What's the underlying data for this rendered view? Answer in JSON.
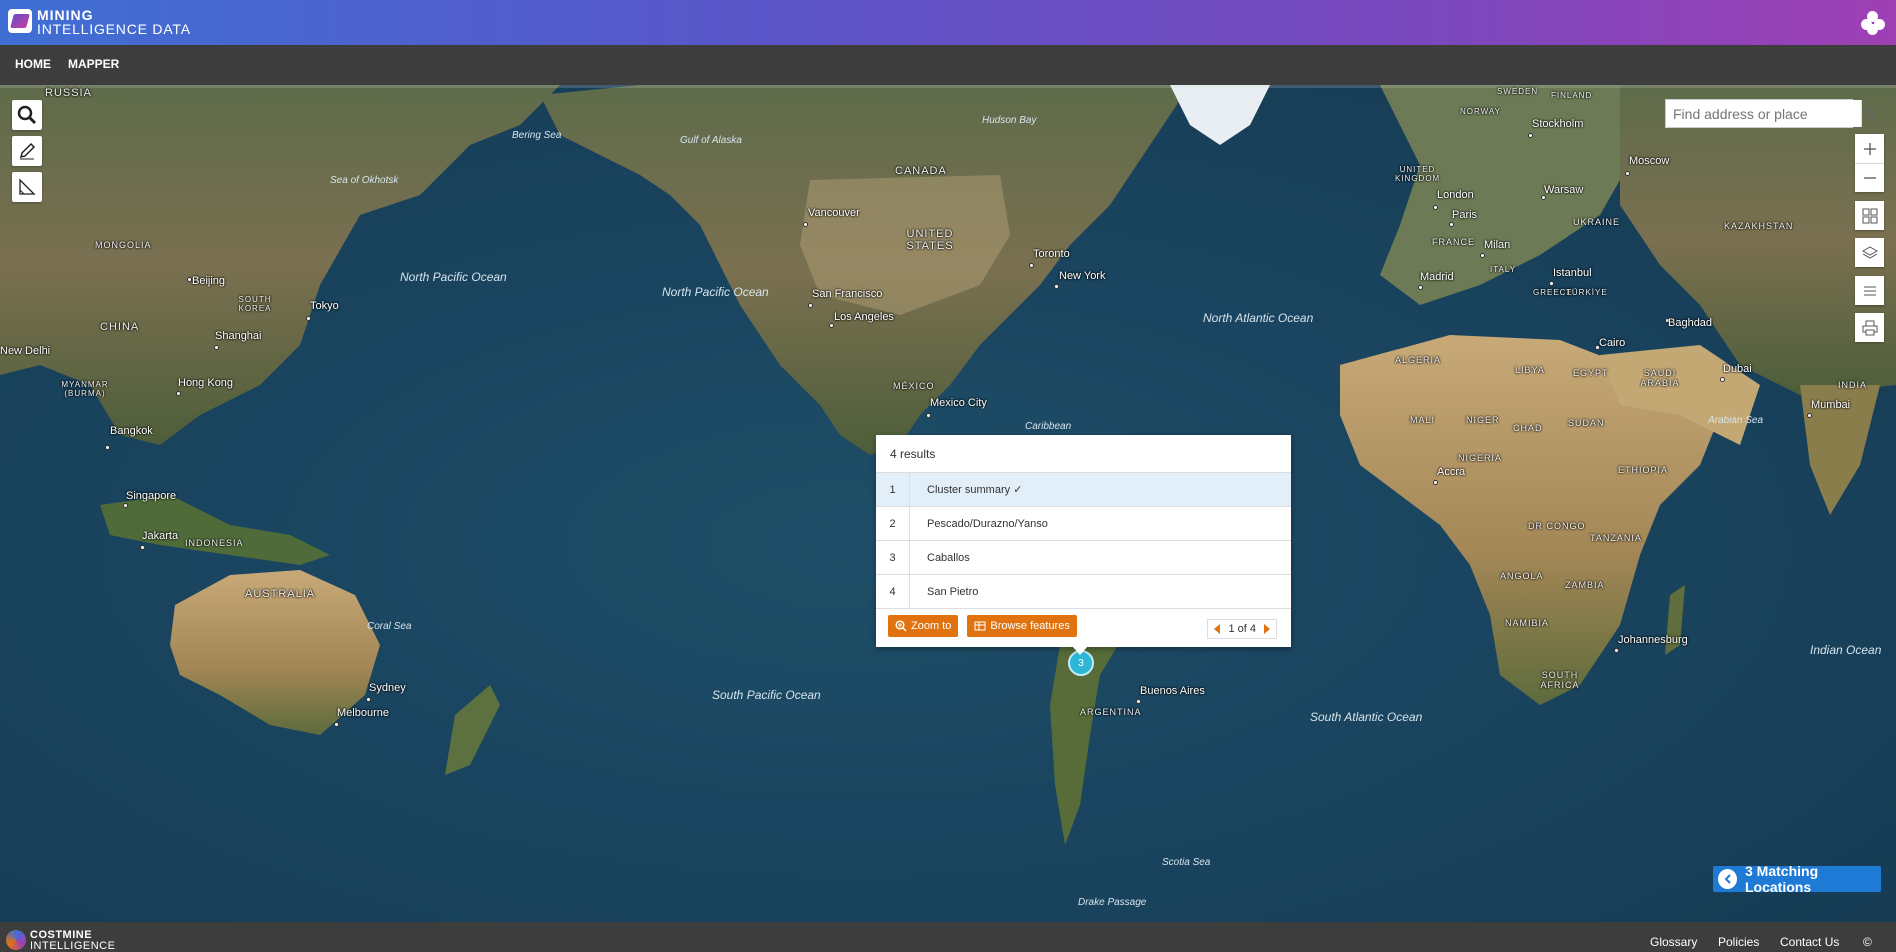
{
  "header": {
    "brand_line1": "MINING",
    "brand_line2": "INTELLIGENCE DATA"
  },
  "nav": {
    "home": "HOME",
    "mapper": "MAPPER"
  },
  "map": {
    "search_placeholder": "Find address or place",
    "labels": {
      "russia": "RUSSIA",
      "canada": "CANADA",
      "united_states": "UNITED STATES",
      "mexico": "MÉXICO",
      "china": "CHINA",
      "mongolia": "MONGOLIA",
      "australia": "AUSTRALIA",
      "indonesia": "INDONESIA",
      "algeria": "ALGERIA",
      "libya": "LIBYA",
      "egypt": "EGYPT",
      "sudan": "SUDAN",
      "chad": "CHAD",
      "niger": "NIGER",
      "mali": "MALI",
      "nigeria": "NIGERIA",
      "ethiopia": "ETHIOPIA",
      "dr_congo": "DR CONGO",
      "tanzania": "TANZANIA",
      "angola": "ANGOLA",
      "zambia": "ZAMBIA",
      "namibia": "NAMIBIA",
      "south_africa": "SOUTH AFRICA",
      "saudi_arabia": "SAUDI ARABIA",
      "argentina": "ARGENTINA",
      "ukraine": "UKRAINE",
      "kazakhstan": "KAZAKHSTAN",
      "france": "FRANCE",
      "united_kingdom": "UNITED KINGDOM",
      "norway": "NORWAY",
      "sweden": "SWEDEN",
      "finland": "FINLAND",
      "italy": "ITALY",
      "greece": "GREECE",
      "turkiye": "TÜRKİYE",
      "india": "INDIA",
      "south_korea": "SOUTH KOREA",
      "myanmar": "MYANMAR (BURMA)",
      "north_pacific_1": "North Pacific Ocean",
      "north_pacific_2": "North Pacific Ocean",
      "south_pacific": "South Pacific Ocean",
      "north_atlantic": "North Atlantic Ocean",
      "south_atlantic": "South Atlantic Ocean",
      "indian_ocean": "Indian Ocean",
      "bering_sea": "Bering Sea",
      "gulf_alaska": "Gulf of Alaska",
      "sea_okhotsk": "Sea of Okhotsk",
      "hudson_bay": "Hudson Bay",
      "coral_sea": "Coral Sea",
      "scotia_sea": "Scotia Sea",
      "drake_passage": "Drake Passage",
      "arabian_sea": "Arabian Sea",
      "caribbean": "Caribbean",
      "vancouver": "Vancouver",
      "toronto": "Toronto",
      "new_york": "New York",
      "san_francisco": "San Francisco",
      "los_angeles": "Los Angeles",
      "mexico_city": "Mexico City",
      "beijing": "Beijing",
      "shanghai": "Shanghai",
      "tokyo": "Tokyo",
      "hong_kong": "Hong Kong",
      "bangkok": "Bangkok",
      "singapore": "Singapore",
      "jakarta": "Jakarta",
      "new_delhi": "New Delhi",
      "sydney": "Sydney",
      "melbourne": "Melbourne",
      "buenos_aires": "Buenos Aires",
      "london": "London",
      "paris": "Paris",
      "madrid": "Madrid",
      "milan": "Milan",
      "warsaw": "Warsaw",
      "moscow": "Moscow",
      "stockholm": "Stockholm",
      "istanbul": "Istanbul",
      "cairo": "Cairo",
      "baghdad": "Baghdad",
      "dubai": "Dubai",
      "mumbai": "Mumbai",
      "accra": "Accra",
      "johannesburg": "Johannesburg"
    }
  },
  "popup": {
    "header": "4 results",
    "rows": [
      {
        "num": "1",
        "label": "Cluster summary",
        "check": "✓"
      },
      {
        "num": "2",
        "label": "Pescado/Durazno/Yanso"
      },
      {
        "num": "3",
        "label": "Caballos"
      },
      {
        "num": "4",
        "label": "San Pietro"
      }
    ],
    "zoom_to": "Zoom to",
    "browse_features": "Browse features",
    "pager": "1 of 4"
  },
  "cluster_count": "3",
  "matching_locations": "3 Matching Locations",
  "footer": {
    "brand_line1": "COSTMINE",
    "brand_line2": "INTELLIGENCE",
    "glossary": "Glossary",
    "policies": "Policies",
    "contact": "Contact Us",
    "copyright": "©"
  }
}
